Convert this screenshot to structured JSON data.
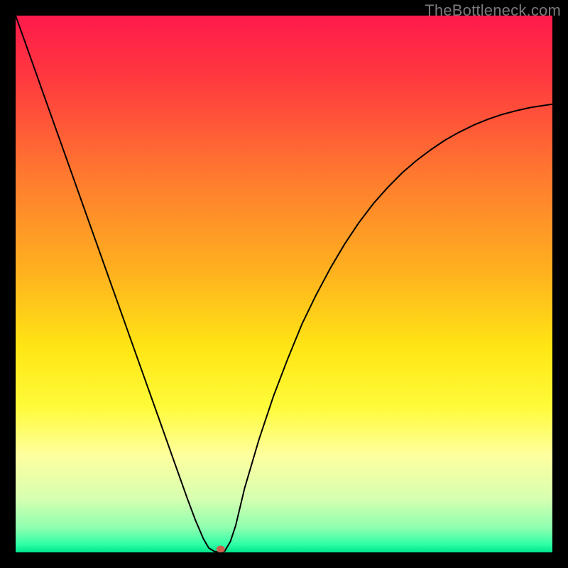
{
  "watermark": "TheBottleneck.com",
  "chart_data": {
    "type": "line",
    "title": "",
    "xlabel": "",
    "ylabel": "",
    "xlim": [
      0,
      100
    ],
    "ylim": [
      0,
      100
    ],
    "grid": false,
    "legend": false,
    "background_gradient": {
      "stops": [
        {
          "offset": 0.0,
          "color": "#ff1a4b"
        },
        {
          "offset": 0.12,
          "color": "#ff3a3f"
        },
        {
          "offset": 0.3,
          "color": "#ff7a2f"
        },
        {
          "offset": 0.48,
          "color": "#ffb21e"
        },
        {
          "offset": 0.62,
          "color": "#ffe615"
        },
        {
          "offset": 0.73,
          "color": "#fffb3a"
        },
        {
          "offset": 0.82,
          "color": "#feffa0"
        },
        {
          "offset": 0.9,
          "color": "#d6ffb0"
        },
        {
          "offset": 0.955,
          "color": "#8dffb0"
        },
        {
          "offset": 0.985,
          "color": "#2fffa6"
        },
        {
          "offset": 1.0,
          "color": "#00e58b"
        }
      ]
    },
    "series": [
      {
        "name": "bottleneck-curve",
        "color": "#000000",
        "x": [
          0.0,
          2.67,
          5.33,
          8.0,
          10.67,
          13.33,
          16.0,
          18.67,
          21.33,
          24.0,
          26.67,
          29.33,
          32.0,
          33.5,
          35.0,
          36.0,
          37.0,
          37.9,
          38.5,
          39.0,
          40.0,
          41.0,
          42.67,
          45.33,
          48.0,
          50.67,
          53.33,
          56.0,
          58.67,
          61.33,
          64.0,
          66.67,
          69.33,
          72.0,
          74.67,
          77.33,
          80.0,
          82.67,
          85.33,
          88.0,
          90.67,
          93.33,
          96.0,
          98.67,
          100.0
        ],
        "y": [
          100.0,
          92.5,
          85.0,
          77.5,
          70.0,
          62.5,
          55.0,
          47.5,
          40.0,
          32.5,
          25.0,
          17.5,
          10.0,
          6.0,
          2.5,
          0.8,
          0.2,
          0.0,
          0.0,
          0.3,
          2.0,
          5.0,
          12.0,
          21.0,
          29.0,
          36.0,
          42.5,
          48.0,
          53.0,
          57.5,
          61.5,
          65.0,
          68.0,
          70.7,
          73.0,
          75.0,
          76.8,
          78.3,
          79.6,
          80.7,
          81.6,
          82.3,
          82.9,
          83.3,
          83.5
        ]
      }
    ],
    "marker": {
      "name": "optimal-point",
      "x": 38.2,
      "y": 0.6,
      "rx": 6,
      "ry": 5,
      "color": "#c9604f"
    }
  }
}
